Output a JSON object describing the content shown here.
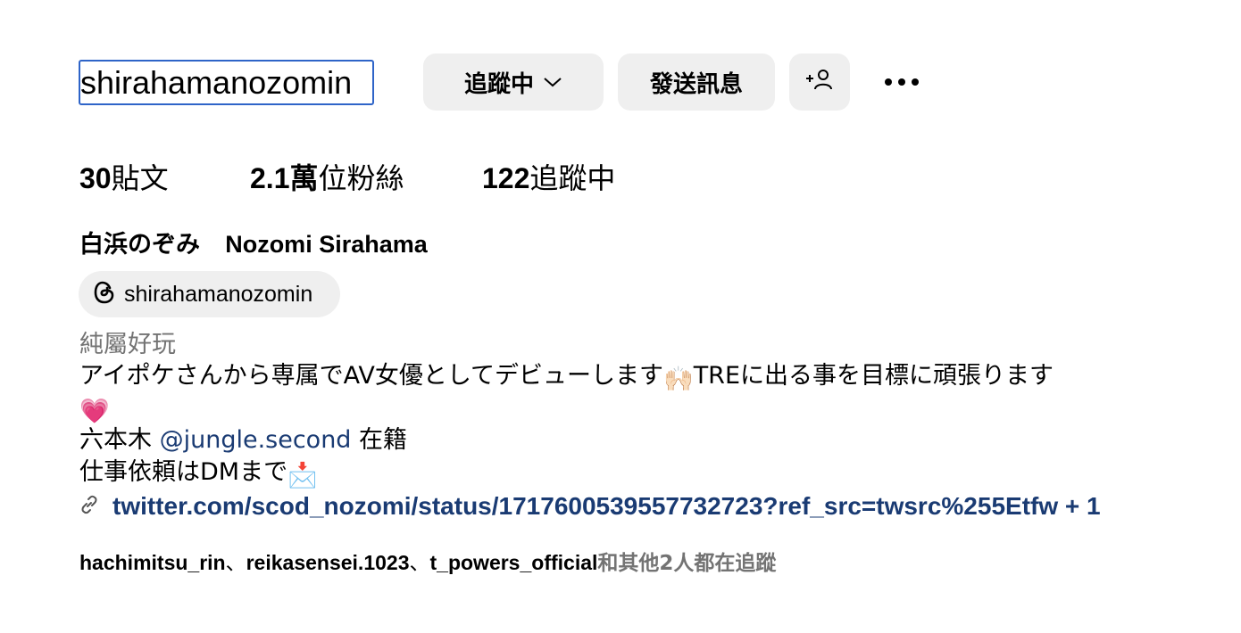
{
  "profile": {
    "username": "shirahamanozomin",
    "follow_button": "追蹤中",
    "message_button": "發送訊息",
    "add_person_icon": "add-person-icon",
    "more_icon": "more-horizontal-icon"
  },
  "stats": {
    "posts_count": "30",
    "posts_label": "貼文",
    "followers_count": "2.1萬",
    "followers_label": "位粉絲",
    "following_count": "122",
    "following_label": "追蹤中"
  },
  "name": {
    "jp": "白浜のぞみ",
    "latin": "Nozomi Sirahama"
  },
  "threads": {
    "icon": "threads-icon",
    "handle": "shirahamanozomin"
  },
  "bio": {
    "category": "純屬好玩",
    "line1_a": "アイポケさんから専属でAV女優としてデビューします",
    "line1_emoji": "🙌🏻",
    "line1_b": "TREに出る事を目標に頑張ります",
    "heart_emoji": "💗",
    "line3_a": "六本木 ",
    "line3_mention": "@jungle.second",
    "line3_b": " 在籍",
    "line4_a": "仕事依頼はDMまで",
    "line4_emoji": "📩",
    "link": "twitter.com/scod_nozomi/status/1717600539557732723?ref_src=twsrc%255Etfw + 1",
    "link_icon": "link-icon"
  },
  "followed_by": {
    "users": [
      "hachimitsu_rin",
      "reikasensei.1023",
      "t_powers_official"
    ],
    "separator": "、",
    "suffix": "和其他2人都在追蹤"
  },
  "colors": {
    "link": "#1a3b73",
    "button_bg": "#efefef",
    "muted": "#737373",
    "focus_border": "#2e64c8"
  }
}
